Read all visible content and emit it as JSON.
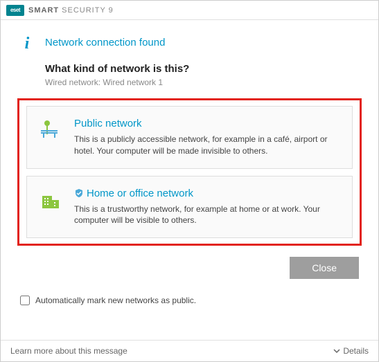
{
  "titlebar": {
    "logo_text": "eset",
    "product_bold": "SMART",
    "product_rest": " SECURITY 9"
  },
  "header": {
    "title": "Network connection found"
  },
  "prompt": {
    "question": "What kind of network is this?",
    "network_label": "Wired network: Wired network 1"
  },
  "options": {
    "public": {
      "title": "Public network",
      "desc": "This is a publicly accessible network, for example in a café, airport or hotel. Your computer will be made invisible to others."
    },
    "home": {
      "title": "Home or office network",
      "desc": "This is a trustworthy network, for example at home or at work. Your computer will be visible to others."
    }
  },
  "buttons": {
    "close": "Close"
  },
  "checkbox": {
    "label": "Automatically mark new networks as public."
  },
  "footer": {
    "learn_more": "Learn more about this message",
    "details": "Details"
  }
}
